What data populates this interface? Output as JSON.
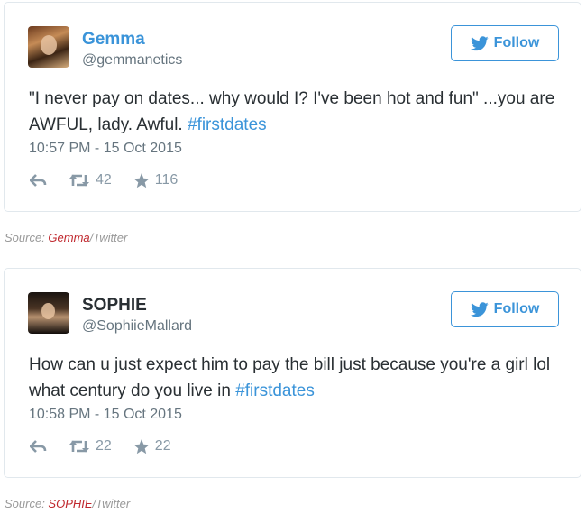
{
  "tweets": [
    {
      "name": "Gemma",
      "handle": "@gemmanetics",
      "follow_label": "Follow",
      "text_plain": "\"I never pay on dates... why would I? I've been hot and fun\" ...you are AWFUL, lady. Awful. ",
      "hashtag": "#firstdates",
      "timestamp": "10:57 PM - 15 Oct 2015",
      "retweets": "42",
      "favorites": "116"
    },
    {
      "name": "SOPHIE",
      "handle": "@SophiieMallard",
      "follow_label": "Follow",
      "text_plain": "How can u just expect him to pay the bill just because you're a girl lol what century do you live in ",
      "hashtag": "#firstdates",
      "timestamp": "10:58 PM - 15 Oct 2015",
      "retweets": "22",
      "favorites": "22"
    }
  ],
  "sources": [
    {
      "prefix": "Source: ",
      "name": "Gemma",
      "suffix": "/Twitter"
    },
    {
      "prefix": "Source: ",
      "name": "SOPHIE",
      "suffix": "/Twitter"
    }
  ],
  "colors": {
    "accent": "#3b94d9",
    "text": "#292f33",
    "muted": "#66757f",
    "action_icons": "#8899a6",
    "source_name": "#c0272d",
    "border": "#e1e8ed"
  },
  "icons": [
    "twitter-bird-icon",
    "reply-icon",
    "retweet-icon",
    "favorite-star-icon"
  ]
}
